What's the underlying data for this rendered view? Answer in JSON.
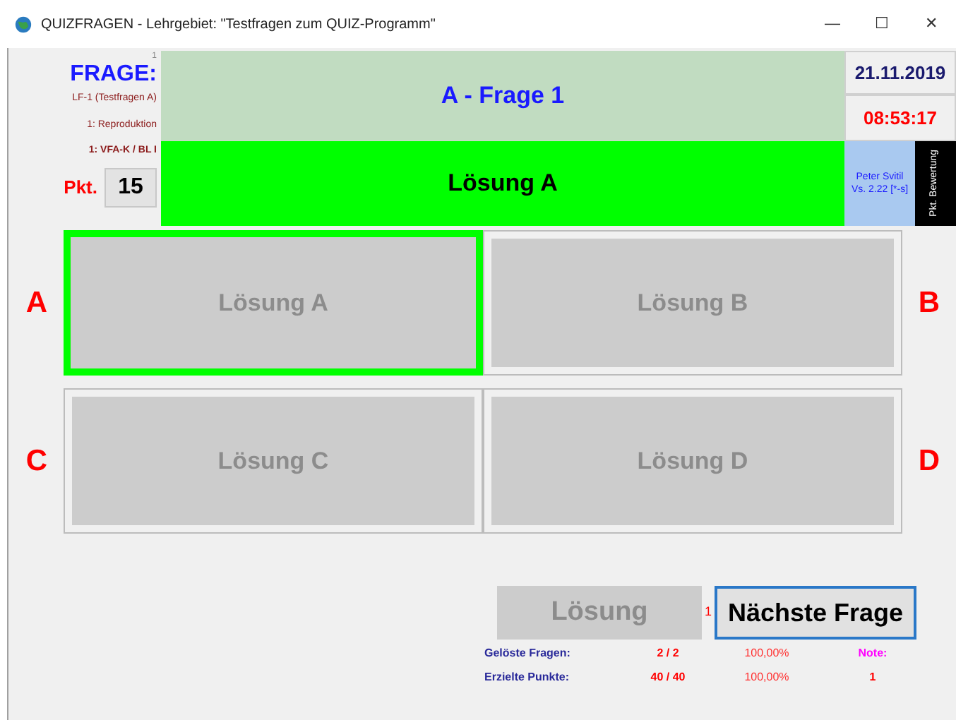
{
  "window": {
    "title": "QUIZFRAGEN - Lehrgebiet: \"Testfragen zum QUIZ-Programm\"",
    "controls": [
      "—",
      "☐",
      "✕"
    ]
  },
  "info": {
    "counter": "1",
    "heading": "FRAGE:",
    "field": "LF-1  (Testfragen A)",
    "level": "1: Reproduktion",
    "code": "1: VFA-K / BL I",
    "points_label": "Pkt.",
    "points": "15"
  },
  "question": "A - Frage 1",
  "date": "21.11.2019",
  "time": "08:53:17",
  "solution": "Lösung A",
  "author": {
    "name": "Peter Svitil",
    "version": "Vs. 2.22 [*-s]"
  },
  "rating_label": "Pkt. Bewertung",
  "answers": [
    {
      "letter": "A",
      "text": "Lösung A",
      "selected": true
    },
    {
      "letter": "B",
      "text": "Lösung B",
      "selected": false
    },
    {
      "letter": "C",
      "text": "Lösung C",
      "selected": false
    },
    {
      "letter": "D",
      "text": "Lösung D",
      "selected": false
    }
  ],
  "solve_button": {
    "label": "Lösung",
    "disabled": true
  },
  "attempt": "1",
  "next_button": {
    "label": "Nächste Frage",
    "focused": true
  },
  "stats": [
    {
      "label": "Gelöste Fragen:",
      "value": "2 / 2",
      "percent": "100,00%",
      "extra": "Note:"
    },
    {
      "label": "Erzielte Punkte:",
      "value": "40 / 40",
      "percent": "100,00%",
      "extra": "1"
    }
  ]
}
